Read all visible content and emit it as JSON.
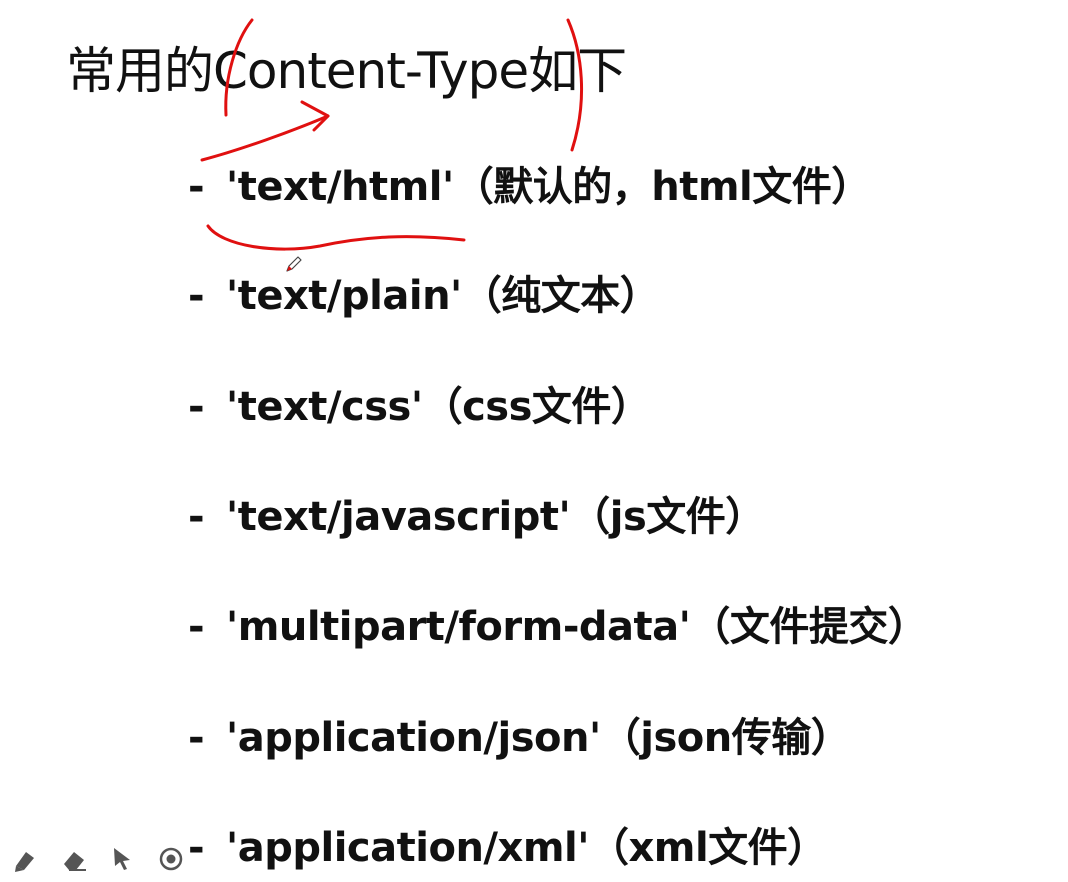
{
  "slide": {
    "title": "常用的Content-Type如下",
    "bullet": "-",
    "items": [
      {
        "text": "'text/html'（默认的，html文件）"
      },
      {
        "text": "'text/plain'（纯文本）"
      },
      {
        "text": "'text/css'（css文件）"
      },
      {
        "text": "'text/javascript'（js文件）"
      },
      {
        "text": "'multipart/form-data'（文件提交）"
      },
      {
        "text": "'application/json'（json传输）"
      },
      {
        "text": "'application/xml'（xml文件）"
      }
    ]
  },
  "annotation": {
    "ink_color": "#e01010"
  },
  "toolbar": {
    "tools": [
      "pen-icon",
      "eraser-icon",
      "pointer-icon",
      "target-icon"
    ],
    "icon_color": "#555555"
  }
}
